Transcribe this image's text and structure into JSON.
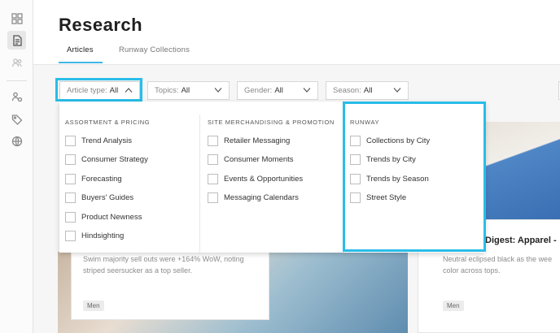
{
  "header": {
    "title": "Research",
    "tabs": [
      {
        "label": "Articles",
        "active": true
      },
      {
        "label": "Runway Collections",
        "active": false
      }
    ]
  },
  "sidebar": {
    "icons": [
      "dashboard-icon",
      "document-icon",
      "people-icon",
      "users-gear-icon",
      "tags-icon",
      "globe-icon"
    ]
  },
  "filters": {
    "article_type": {
      "label": "Article type:",
      "value": "All"
    },
    "topics": {
      "label": "Topics:",
      "value": "All"
    },
    "gender": {
      "label": "Gender:",
      "value": "All"
    },
    "season": {
      "label": "Season:",
      "value": "All"
    }
  },
  "dropdown": {
    "columns": [
      {
        "heading": "ASSORTMENT & PRICING",
        "options": [
          "Trend Analysis",
          "Consumer Strategy",
          "Forecasting",
          "Buyers' Guides",
          "Product Newness",
          "Hindsighting"
        ]
      },
      {
        "heading": "SITE MERCHANDISING & PROMOTION",
        "options": [
          "Retailer Messaging",
          "Consumer Moments",
          "Events & Opportunities",
          "Messaging Calendars"
        ]
      },
      {
        "heading": "RUNWAY",
        "options": [
          "Collections by City",
          "Trends by City",
          "Trends by Season",
          "Street Style"
        ]
      }
    ]
  },
  "cards": [
    {
      "snippet_line1": "Swim majority sell outs were +164% WoW, noting",
      "snippet_line2": "striped seersucker as a top seller.",
      "tag": "Men"
    },
    {
      "title": "Digest: Apparel -",
      "snippet_line1": "Neutral eclipsed black as the wee",
      "snippet_line2": "color across tops.",
      "tag": "Men"
    }
  ],
  "colors": {
    "accent": "#3fb6e4",
    "highlight": "#29bde8"
  }
}
